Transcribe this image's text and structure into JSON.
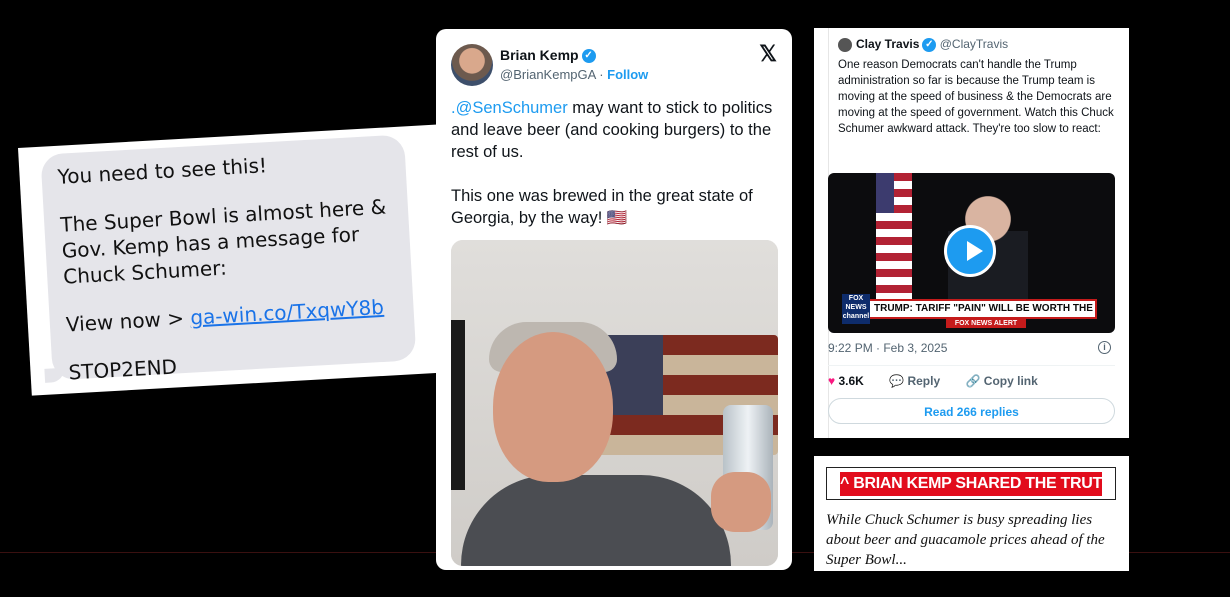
{
  "sms": {
    "line1": "You need to see this!",
    "line2": "The Super Bowl is almost here &",
    "line3": "Gov. Kemp has a message for",
    "line4": "Chuck Schumer:",
    "view_prefix": "View now > ",
    "link": "ga-win.co/TxqwY8b",
    "stop": "STOP2END",
    "link_color": "#1a73e8"
  },
  "tweet1": {
    "name": "Brian Kemp",
    "handle": "@BrianKempGA",
    "dot": " · ",
    "follow": "Follow",
    "x_icon": "x-logo-icon",
    "mention": ".@SenSchumer",
    "text_rest": " may want to stick to politics and leave beer (and cooking burgers) to the rest of us.",
    "text2": "This one was brewed in the great state of Georgia, by the way! ",
    "flag_emoji": "🇺🇸",
    "accent": "#1d9bf0"
  },
  "tweet2": {
    "name": "Clay Travis",
    "handle": "@ClayTravis",
    "text": "One reason Democrats can't handle the Trump administration so far is because the Trump team is moving at the speed of business & the Democrats are moving at the speed of government. Watch this Chuck Schumer awkward attack. They're too slow to react:",
    "chyron": "TRUMP: TARIFF \"PAIN\" WILL BE WORTH THE PRICE",
    "fox_logo": "FOX NEWS channel",
    "alert": "FOX NEWS ALERT",
    "time": "9:22 PM · Feb 3, 2025",
    "likes": "3.6K",
    "reply": "Reply",
    "copy_link": "Copy link",
    "read_replies": "Read 266 replies"
  },
  "truth": {
    "banner": "^ BRIAN KEMP SHARED THE TRUTH ^",
    "text": "While Chuck Schumer is busy spreading lies about beer and guacamole prices ahead of the Super Bowl...",
    "banner_color": "#e20c1c"
  }
}
